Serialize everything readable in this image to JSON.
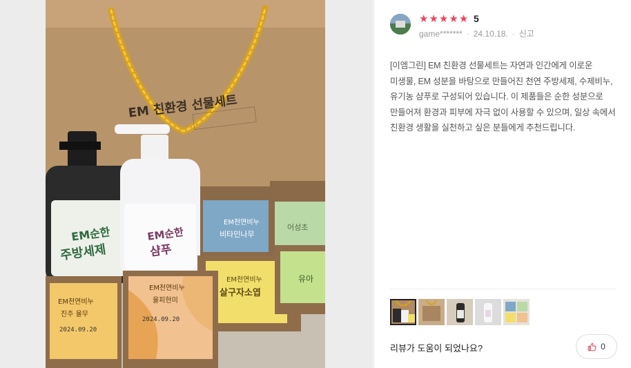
{
  "review": {
    "rating_stars": 5,
    "score_label": "5",
    "reviewer": "game*******",
    "date": "24.10.18.",
    "report_label": "신고",
    "body": "[이엠그린] EM 친환경 선물세트는 자연과 인간에게 이로운 미생물, EM 성분을 바탕으로 만들어진 천연 주방세제, 수제비누, 유기농 샴푸로 구성되어 있습니다. 이 제품들은 순한 성분으로 만들어져 환경과 피부에 자극 없이 사용할 수 있으며, 일상 속에서 친환경 생활을 실천하고 싶은 분들에게 추천드립니다."
  },
  "photo": {
    "bag_text": "EM 친환경 선물세트",
    "dish_soap": "EM순한\n주방세제",
    "shampoo": "EM순한\n샴푸",
    "box1": "EM천연비누\n비타민나무",
    "box2": "어성초",
    "box3": "EM천연비누\n살구자소엽",
    "box4": "유아",
    "box5": "EM천연비누\n진주 율무",
    "box6": "EM천연비누\n율피현미",
    "date_stamp": "2024.09.20"
  },
  "thumbnails": [
    {
      "name": "thumb-1",
      "active": true
    },
    {
      "name": "thumb-2",
      "active": false
    },
    {
      "name": "thumb-3",
      "active": false
    },
    {
      "name": "thumb-4",
      "active": false
    },
    {
      "name": "thumb-5",
      "active": false
    }
  ],
  "helpful": {
    "question": "리뷰가 도움이 되었나요?",
    "count": "0"
  },
  "colors": {
    "star": "#f0425c",
    "bag_handle": "#d8a21c"
  }
}
